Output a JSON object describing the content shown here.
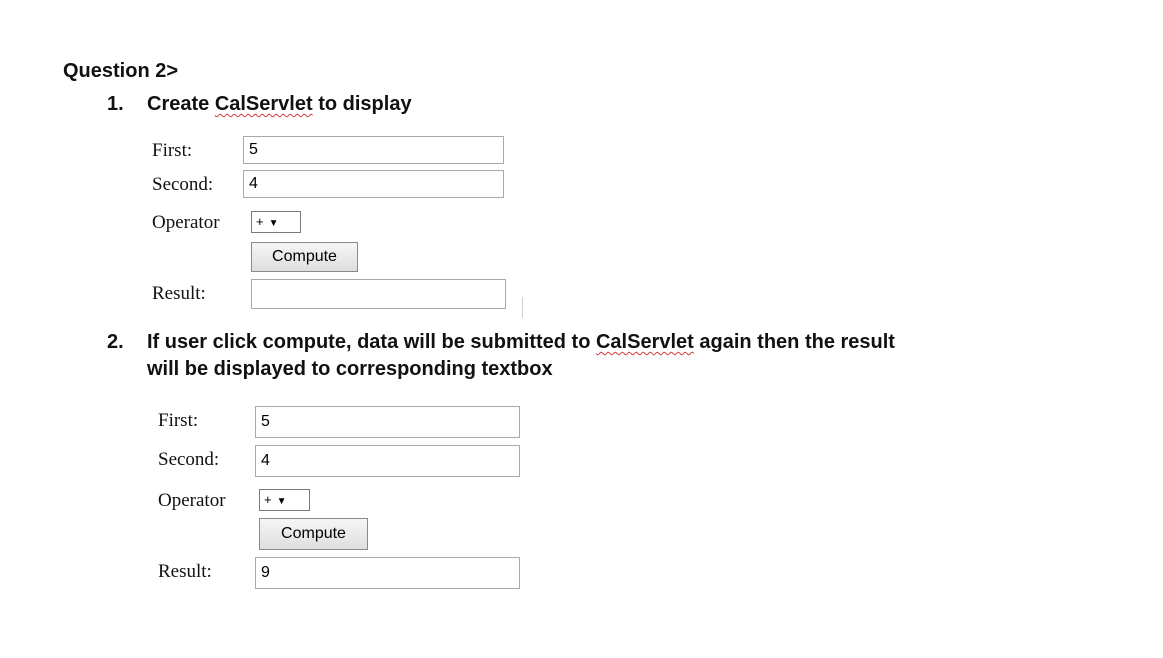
{
  "heading": "Question 2>",
  "items": [
    {
      "number": "1.",
      "text_before": "Create ",
      "text_flagged": "CalServlet",
      "text_after": " to display"
    },
    {
      "number": "2.",
      "line1_before": "If user click compute, data will be submitted to ",
      "line1_flagged": "CalServlet",
      "line1_after": " again then the result",
      "line2": "will be displayed to corresponding textbox"
    }
  ],
  "forms": [
    {
      "first_label": "First:",
      "first_value": "5",
      "second_label": "Second:",
      "second_value": "4",
      "operator_label": "Operator",
      "operator_value": "+",
      "operator_arrow": "▼",
      "compute_label": "Compute",
      "result_label": "Result:",
      "result_value": ""
    },
    {
      "first_label": "First:",
      "first_value": "5",
      "second_label": "Second:",
      "second_value": "4",
      "operator_label": "Operator",
      "operator_value": "+",
      "operator_arrow": "▼",
      "compute_label": "Compute",
      "result_label": "Result:",
      "result_value": "9"
    }
  ]
}
